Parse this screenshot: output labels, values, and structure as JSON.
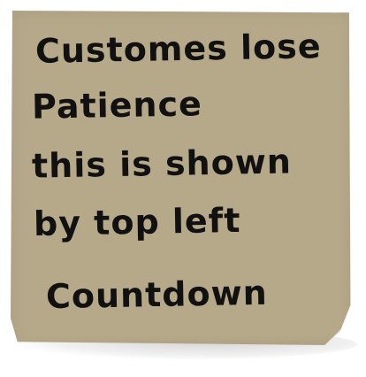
{
  "note": {
    "lines": [
      "Customes lose",
      "Patience",
      "this is shown",
      "by top left",
      "Countdown"
    ],
    "colors": {
      "paper": "#b6a98a",
      "ink": "#111111",
      "background": "#ffffff"
    }
  }
}
